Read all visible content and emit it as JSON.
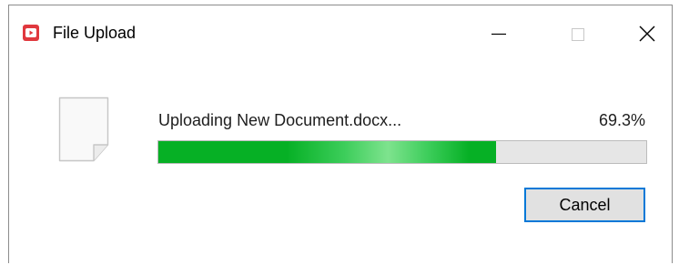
{
  "window": {
    "title": "File Upload",
    "app_icon": "video-play-icon",
    "controls": {
      "minimize_icon": "minimize-icon",
      "maximize_icon": "maximize-icon",
      "close_icon": "close-icon"
    }
  },
  "upload": {
    "file_icon": "document-icon",
    "status": "Uploading New Document.docx...",
    "percent_label": "69.3%",
    "progress": 0.693
  },
  "actions": {
    "cancel_label": "Cancel"
  },
  "colors": {
    "app_icon": "#e0383e",
    "progress_fill": "#06b025",
    "progress_track": "#e6e6e6",
    "focus_border": "#0078d7"
  }
}
